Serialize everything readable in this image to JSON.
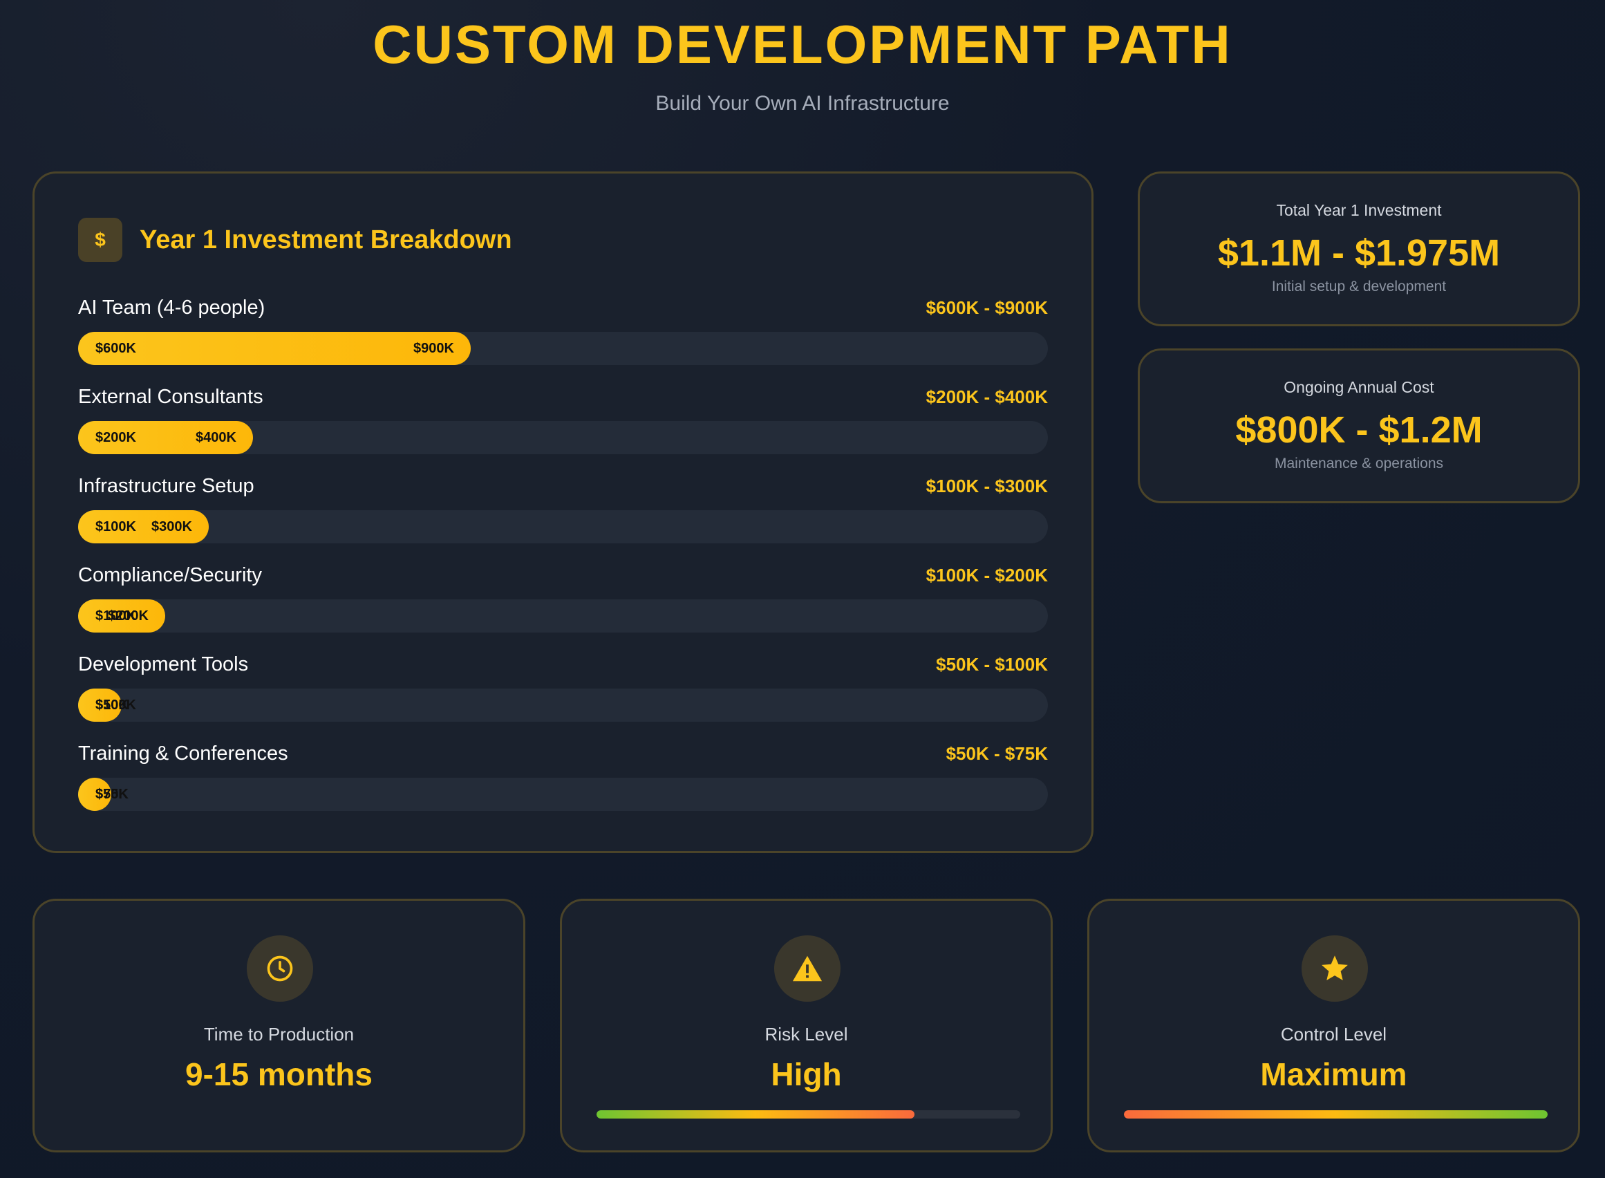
{
  "header": {
    "title": "CUSTOM DEVELOPMENT PATH",
    "subtitle": "Build Your Own AI Infrastructure"
  },
  "breakdown": {
    "icon": "dollar-icon",
    "symbol": "$",
    "title": "Year 1 Investment Breakdown",
    "scale_max_k": 2000,
    "items": [
      {
        "label": "AI Team (4-6 people)",
        "range": "$600K - $900K",
        "min_label": "$600K",
        "max_label": "$900K",
        "min_k": 600,
        "max_k": 900
      },
      {
        "label": "External Consultants",
        "range": "$200K - $400K",
        "min_label": "$200K",
        "max_label": "$400K",
        "min_k": 200,
        "max_k": 400
      },
      {
        "label": "Infrastructure Setup",
        "range": "$100K - $300K",
        "min_label": "$100K",
        "max_label": "$300K",
        "min_k": 100,
        "max_k": 300
      },
      {
        "label": "Compliance/Security",
        "range": "$100K - $200K",
        "min_label": "$100K",
        "max_label": "$200K",
        "min_k": 100,
        "max_k": 200
      },
      {
        "label": "Development Tools",
        "range": "$50K - $100K",
        "min_label": "$50K",
        "max_label": "$100K",
        "min_k": 50,
        "max_k": 100
      },
      {
        "label": "Training & Conferences",
        "range": "$50K - $75K",
        "min_label": "$50K",
        "max_label": "$75K",
        "min_k": 50,
        "max_k": 75
      }
    ]
  },
  "summary": {
    "total": {
      "label": "Total Year 1 Investment",
      "value": "$1.1M - $1.975M",
      "sub": "Initial setup & development"
    },
    "ongoing": {
      "label": "Ongoing Annual Cost",
      "value": "$800K - $1.2M",
      "sub": "Maintenance & operations"
    }
  },
  "metrics": {
    "time": {
      "icon": "clock-icon",
      "label": "Time to Production",
      "value": "9-15 months"
    },
    "risk": {
      "icon": "warning-icon",
      "label": "Risk Level",
      "value": "High",
      "level": 0.75
    },
    "control": {
      "icon": "star-icon",
      "label": "Control Level",
      "value": "Maximum",
      "level": 1.0
    }
  },
  "colors": {
    "accent": "#fcc51c",
    "card_border": "#4b4429",
    "green": "#6ec531",
    "orange": "#fa6a3c"
  }
}
